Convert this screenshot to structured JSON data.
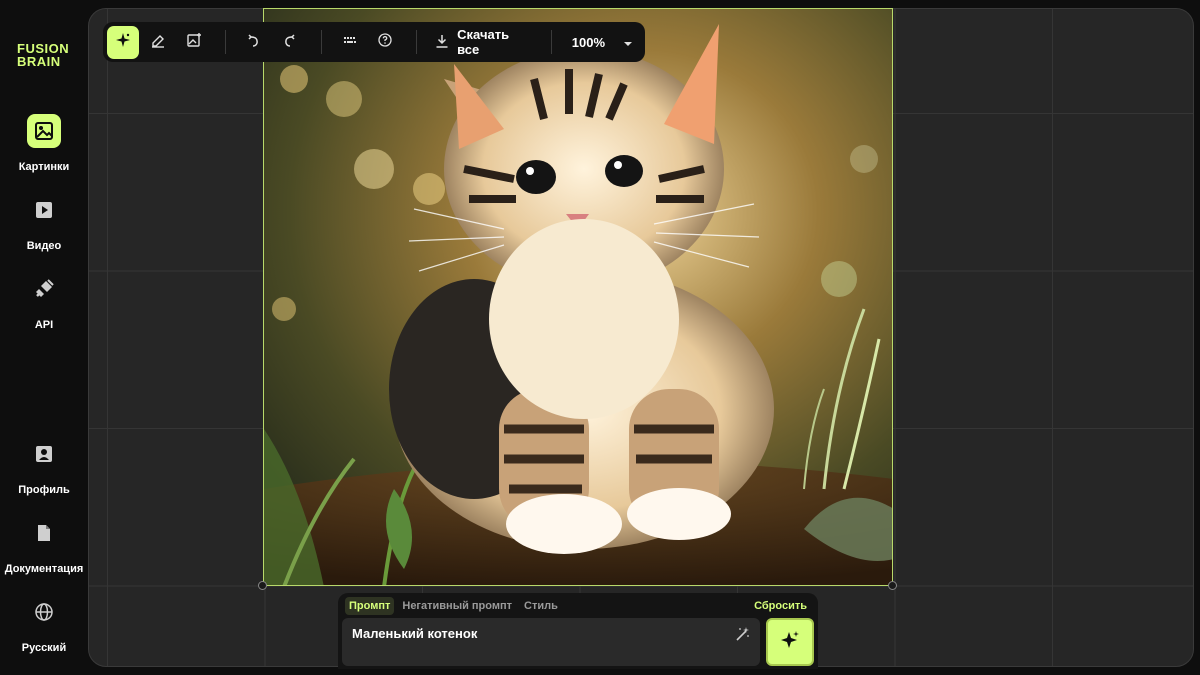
{
  "brand": {
    "line1": "FUSION",
    "line2": "BRAIN"
  },
  "sidebar": {
    "items": [
      {
        "label": "Картинки",
        "icon": "image-icon",
        "active": true
      },
      {
        "label": "Видео",
        "icon": "video-icon",
        "active": false
      },
      {
        "label": "API",
        "icon": "plug-icon",
        "active": false
      },
      {
        "label": "Профиль",
        "icon": "profile-icon",
        "active": false
      },
      {
        "label": "Документация",
        "icon": "document-icon",
        "active": false
      },
      {
        "label": "Русский",
        "icon": "globe-icon",
        "active": false
      }
    ]
  },
  "toolbar": {
    "tools": [
      "sparkle-tool-icon",
      "eraser-icon",
      "image-edit-icon"
    ],
    "undo_icon": "undo-icon",
    "redo_icon": "redo-icon",
    "keyboard_icon": "keyboard-icon",
    "help_icon": "help-icon",
    "download_label": "Скачать все",
    "zoom": "100%"
  },
  "image": {
    "subject": "kitten-image"
  },
  "prompt": {
    "tabs": [
      "Промпт",
      "Негативный промпт",
      "Стиль"
    ],
    "active_tab": "Промпт",
    "reset_label": "Сбросить",
    "value": "Маленький котенок"
  },
  "colors": {
    "accent": "#d6ff7a",
    "panel": "#262626",
    "background": "#0e0e0e"
  }
}
